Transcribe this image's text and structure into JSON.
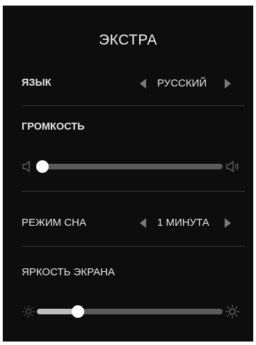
{
  "title": "ЭКСТРА",
  "language": {
    "label": "ЯЗЫК",
    "value": "РУССКИЙ"
  },
  "volume": {
    "label": "ГРОМКОСТЬ",
    "level": 0.03
  },
  "sleep_mode": {
    "label": "РЕЖИМ СНА",
    "value": "1 МИНУТА"
  },
  "brightness": {
    "label": "ЯРКОСТЬ ЭКРАНА",
    "level": 0.22
  },
  "colors": {
    "panel_bg": "#0d0d0d",
    "text": "#e6e6e6",
    "track": "#5b5b5b",
    "fill": "#bdbdbd",
    "knob": "#ffffff",
    "arrow": "#7a7a7a"
  },
  "icons": {
    "volume_min": "speaker-mute-icon",
    "volume_max": "speaker-loud-icon",
    "brightness_min": "sun-dim-icon",
    "brightness_max": "sun-bright-icon",
    "prev": "triangle-left-icon",
    "next": "triangle-right-icon"
  }
}
